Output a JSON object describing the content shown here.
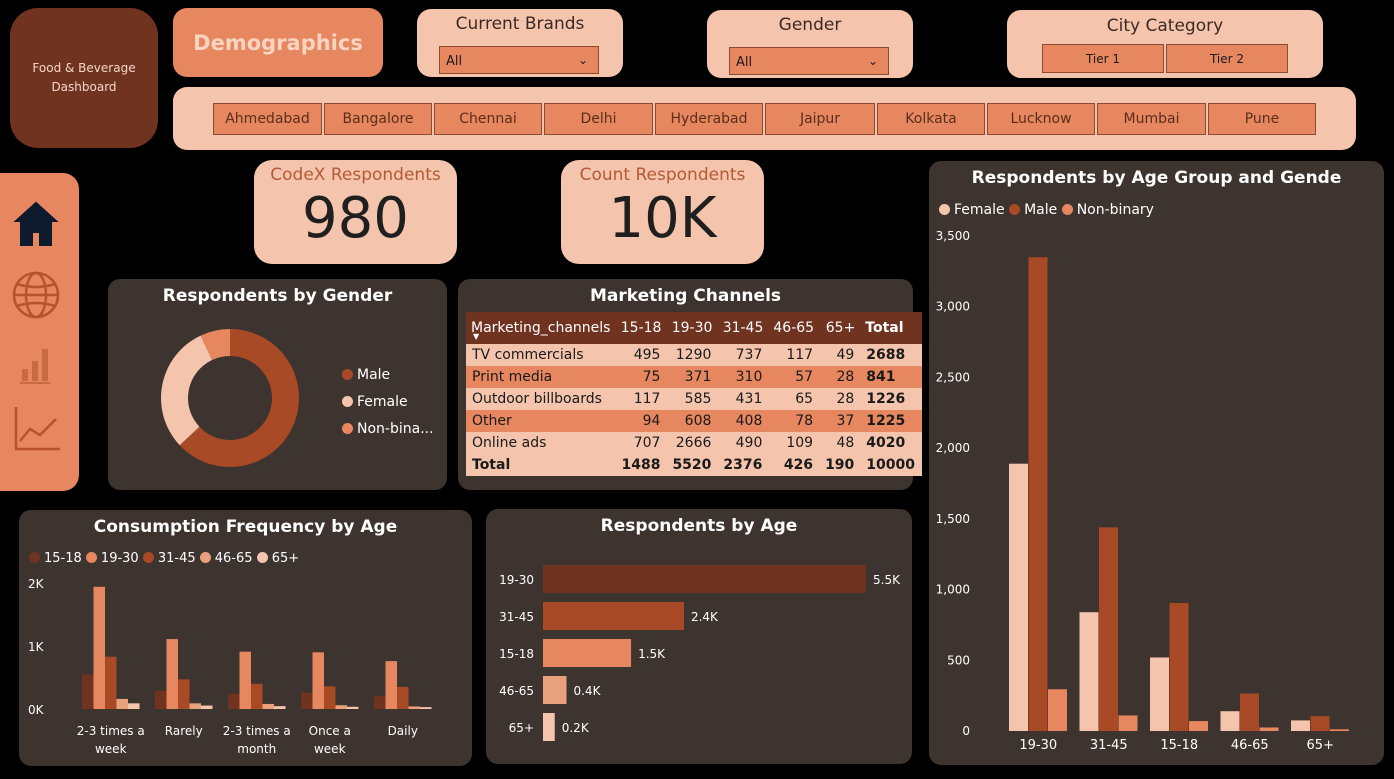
{
  "logo": {
    "line1": "Food & Beverage",
    "line2": "Dashboard"
  },
  "demographics_button": "Demographics",
  "slicers": {
    "brands": {
      "title": "Current Brands",
      "value": "All"
    },
    "gender": {
      "title": "Gender",
      "value": "All"
    },
    "city_category": {
      "title": "City Category",
      "options": [
        "Tier 1",
        "Tier 2"
      ]
    }
  },
  "cities": [
    "Ahmedabad",
    "Bangalore",
    "Chennai",
    "Delhi",
    "Hyderabad",
    "Jaipur",
    "Kolkata",
    "Lucknow",
    "Mumbai",
    "Pune"
  ],
  "nav": {
    "items": [
      "home-icon",
      "globe-icon",
      "bar-chart-icon",
      "line-chart-icon"
    ]
  },
  "kpis": {
    "codex": {
      "title": "CodeX Respondents",
      "value": "980"
    },
    "count": {
      "title": "Count Respondents",
      "value": "10K"
    }
  },
  "colors": {
    "male": "#a84a25",
    "female": "#f4c4ad",
    "nonbinary": "#e6875f",
    "dark": "#6f3320",
    "panel": "#3d332f"
  },
  "gender_chart": {
    "title": "Respondents by Gender",
    "legend": [
      "Male",
      "Female",
      "Non-bina..."
    ],
    "chart_data": {
      "type": "pie",
      "categories": [
        "Male",
        "Female",
        "Non-binary"
      ],
      "values": [
        63,
        30,
        7
      ]
    }
  },
  "marketing": {
    "title": "Marketing Channels",
    "headers": [
      "Marketing_channels",
      "15-18",
      "19-30",
      "31-45",
      "46-65",
      "65+",
      "Total"
    ],
    "rows": [
      [
        "TV commercials",
        "495",
        "1290",
        "737",
        "117",
        "49",
        "2688"
      ],
      [
        "Print media",
        "75",
        "371",
        "310",
        "57",
        "28",
        "841"
      ],
      [
        "Outdoor billboards",
        "117",
        "585",
        "431",
        "65",
        "28",
        "1226"
      ],
      [
        "Other",
        "94",
        "608",
        "408",
        "78",
        "37",
        "1225"
      ],
      [
        "Online ads",
        "707",
        "2666",
        "490",
        "109",
        "48",
        "4020"
      ]
    ],
    "total": [
      "Total",
      "1488",
      "5520",
      "2376",
      "426",
      "190",
      "10000"
    ]
  },
  "age_gender_chart": {
    "title": "Respondents by Age Group and Gende",
    "legend": [
      "Female",
      "Male",
      "Non-binary"
    ],
    "y_ticks": [
      "3,500",
      "3,000",
      "2,500",
      "2,000",
      "1,500",
      "1,000",
      "500",
      "0"
    ],
    "chart_data": {
      "type": "bar",
      "categories": [
        "19-30",
        "31-45",
        "15-18",
        "46-65",
        "65+"
      ],
      "series": [
        {
          "name": "Female",
          "values": [
            1890,
            840,
            520,
            140,
            75
          ]
        },
        {
          "name": "Male",
          "values": [
            3350,
            1440,
            905,
            265,
            105
          ]
        },
        {
          "name": "Non-binary",
          "values": [
            295,
            110,
            70,
            25,
            12
          ]
        }
      ],
      "ylim": [
        0,
        3500
      ]
    }
  },
  "consumption_chart": {
    "title": "Consumption Frequency by Age",
    "legend": [
      "15-18",
      "19-30",
      "31-45",
      "46-65",
      "65+"
    ],
    "y_ticks": [
      "2K",
      "1K",
      "0K"
    ],
    "category_labels": [
      [
        "2-3 times a",
        "week"
      ],
      [
        "Rarely",
        ""
      ],
      [
        "2-3 times a",
        "month"
      ],
      [
        "Once a",
        "week"
      ],
      [
        "Daily",
        ""
      ]
    ],
    "chart_data": {
      "type": "bar",
      "categories": [
        "2-3 times a week",
        "Rarely",
        "2-3 times a month",
        "Once a week",
        "Daily"
      ],
      "series": [
        {
          "name": "15-18",
          "values": [
            550,
            290,
            240,
            260,
            210
          ]
        },
        {
          "name": "19-30",
          "values": [
            1940,
            1110,
            910,
            900,
            760
          ]
        },
        {
          "name": "31-45",
          "values": [
            830,
            470,
            400,
            360,
            350
          ]
        },
        {
          "name": "46-65",
          "values": [
            160,
            90,
            80,
            60,
            40
          ]
        },
        {
          "name": "65+",
          "values": [
            90,
            55,
            45,
            35,
            30
          ]
        }
      ],
      "ylim": [
        0,
        2000
      ]
    }
  },
  "age_chart": {
    "title": "Respondents by Age",
    "chart_data": {
      "type": "bar",
      "categories": [
        "19-30",
        "31-45",
        "15-18",
        "46-65",
        "65+"
      ],
      "values": [
        5.5,
        2.4,
        1.5,
        0.4,
        0.2
      ],
      "labels": [
        "5.5K",
        "2.4K",
        "1.5K",
        "0.4K",
        "0.2K"
      ]
    }
  }
}
